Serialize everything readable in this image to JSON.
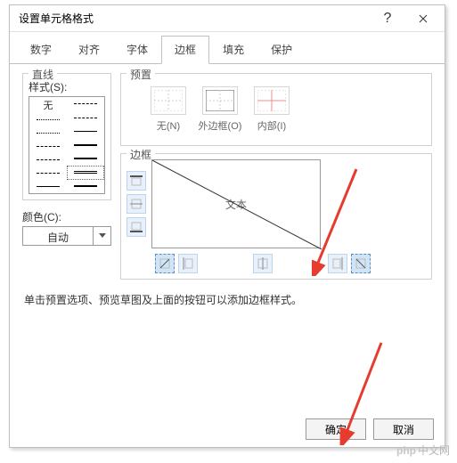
{
  "title": "设置单元格格式",
  "tabs": [
    "数字",
    "对齐",
    "字体",
    "边框",
    "填充",
    "保护"
  ],
  "active_tab": 3,
  "line_group": "直线",
  "style_label": "样式(S):",
  "style_none": "无",
  "color_label": "颜色(C):",
  "color_value": "自动",
  "preset_group": "预置",
  "presets": [
    {
      "label": "无(N)"
    },
    {
      "label": "外边框(O)"
    },
    {
      "label": "内部(I)"
    }
  ],
  "border_group": "边框",
  "preview_text": "文本",
  "hint": "单击预置选项、预览草图及上面的按钮可以添加边框样式。",
  "ok": "确定",
  "cancel": "取消",
  "watermark": "中文网",
  "watermark_logo": "php"
}
